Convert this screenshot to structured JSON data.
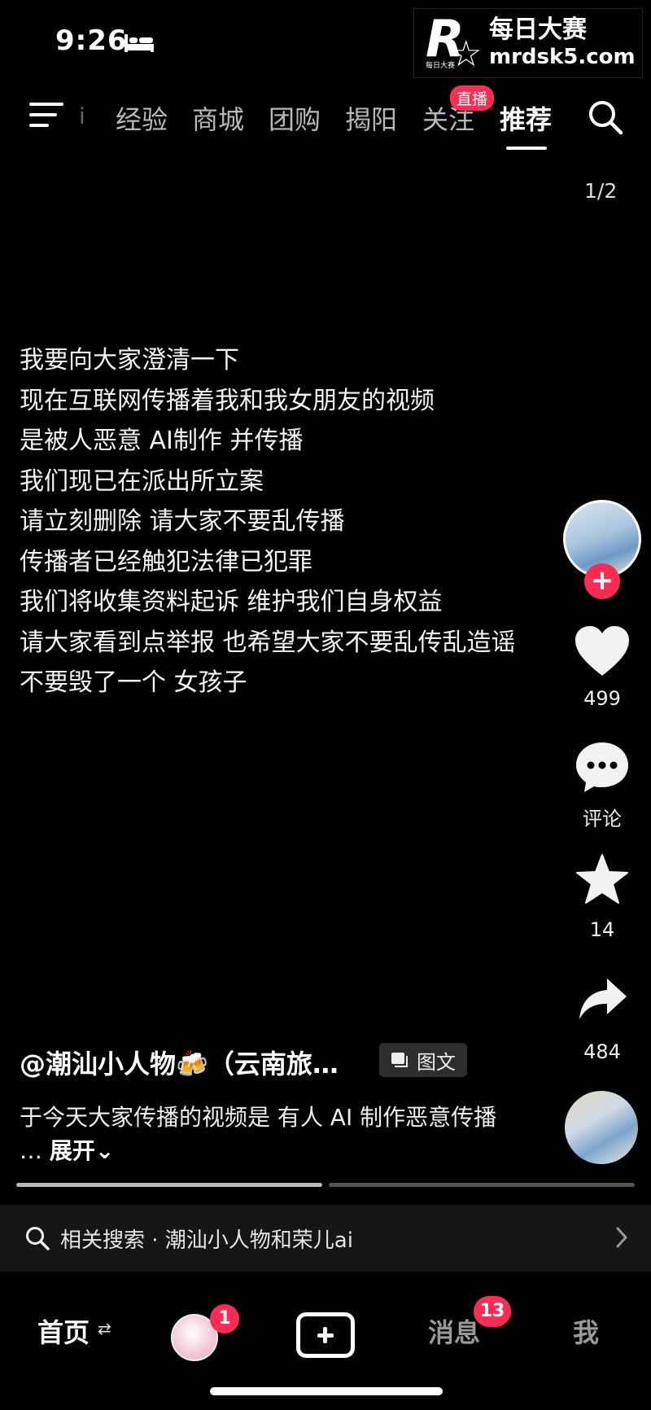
{
  "status_bar": {
    "time": "9:26"
  },
  "watermark": {
    "logo_text": "R",
    "cn": "每日大赛",
    "url": "mrdsk5.com"
  },
  "top_nav": {
    "faded_item": "i",
    "tabs": [
      {
        "label": "经验"
      },
      {
        "label": "商城"
      },
      {
        "label": "团购"
      },
      {
        "label": "揭阳"
      },
      {
        "label": "关注"
      },
      {
        "label": "推荐",
        "active": true
      }
    ],
    "live_badge": "直播"
  },
  "page_indicator": "1/2",
  "post_text": [
    "我要向大家澄清一下",
    "现在互联网传播着我和我女朋友的视频",
    "是被人恶意 AI制作  并传播",
    "我们现已在派出所立案",
    "请立刻删除 请大家不要乱传播",
    "传播者已经触犯法律已犯罪",
    "我们将收集资料起诉  维护我们自身权益",
    "请大家看到点举报 也希望大家不要乱传乱造谣",
    "不要毁了一个 女孩子"
  ],
  "actions": {
    "follow": "+",
    "likes": "499",
    "comment_label": "评论",
    "favorites": "14",
    "shares": "484"
  },
  "author": {
    "handle": "@潮汕小人物🍻（云南旅…",
    "type_tag": "图文"
  },
  "description": {
    "text": "于今天大家传播的视频是 有人 AI 制作恶意传播 …",
    "expand": "展开⌄"
  },
  "related_search": {
    "text": "相关搜索 · 潮汕小人物和荣儿ai"
  },
  "bottom_nav": {
    "home": "首页",
    "home_swap": "⇄",
    "friend_badge": "1",
    "messages": "消息",
    "messages_badge": "13",
    "me": "我"
  },
  "colors": {
    "accent": "#fe2c55",
    "background": "#000000"
  }
}
